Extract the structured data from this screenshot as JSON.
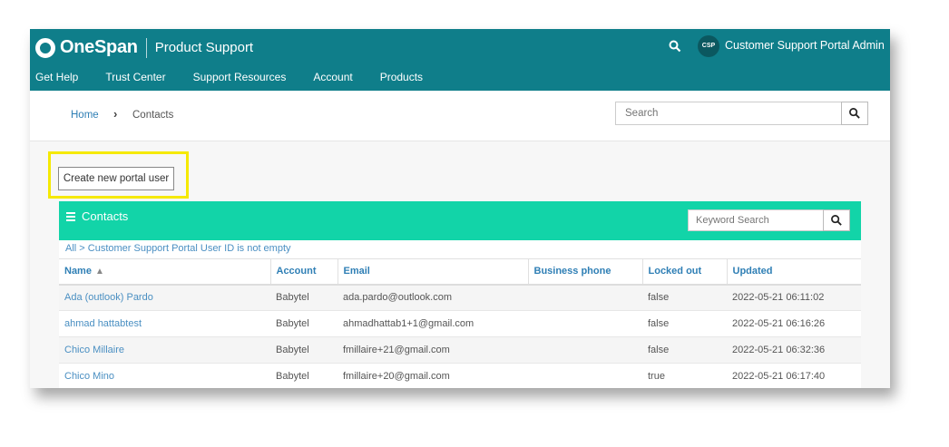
{
  "header": {
    "brand": "OneSpan",
    "product": "Product Support",
    "avatar_initials": "CSP",
    "user_name": "Customer Support Portal Admin",
    "nav": [
      "Get Help",
      "Trust Center",
      "Support Resources",
      "Account",
      "Products"
    ],
    "icons": {
      "search": "search-icon",
      "logo": "onespan-logo-icon"
    }
  },
  "breadcrumb": {
    "home": "Home",
    "current": "Contacts",
    "separator_icon": "chevron-right-icon"
  },
  "site_search": {
    "placeholder": "Search"
  },
  "actions": {
    "create_label": "Create new portal user"
  },
  "contacts": {
    "title": "Contacts",
    "keyword_placeholder": "Keyword Search",
    "filter_text": "All > Customer Support Portal User ID is not empty",
    "columns": [
      "Name",
      "Account",
      "Email",
      "Business phone",
      "Locked out",
      "Updated"
    ],
    "sort_indicator": "^",
    "rows": [
      {
        "name": "Ada (outlook) Pardo",
        "account": "Babytel",
        "email": "ada.pardo@outlook.com",
        "phone": "",
        "locked": "false",
        "updated": "2022-05-21 06:11:02"
      },
      {
        "name": "ahmad hattabtest",
        "account": "Babytel",
        "email": "ahmadhattab1+1@gmail.com",
        "phone": "",
        "locked": "false",
        "updated": "2022-05-21 06:16:26"
      },
      {
        "name": "Chico Millaire",
        "account": "Babytel",
        "email": "fmillaire+21@gmail.com",
        "phone": "",
        "locked": "false",
        "updated": "2022-05-21 06:32:36"
      },
      {
        "name": "Chico Mino",
        "account": "Babytel",
        "email": "fmillaire+20@gmail.com",
        "phone": "",
        "locked": "true",
        "updated": "2022-05-21 06:17:40"
      }
    ]
  },
  "colors": {
    "header_bg": "#0f7e8a",
    "panel_header": "#12d4a8",
    "highlight": "#f5e900",
    "link": "#2f7fb5"
  }
}
